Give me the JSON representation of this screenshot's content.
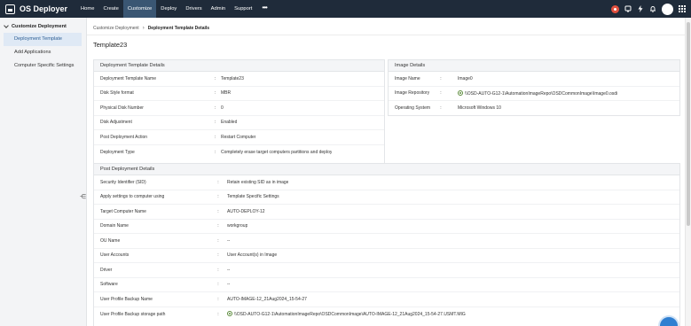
{
  "app": {
    "title": "OS Deployer"
  },
  "nav": {
    "items": [
      {
        "label": "Home",
        "active": false
      },
      {
        "label": "Create",
        "active": false
      },
      {
        "label": "Customize",
        "active": true
      },
      {
        "label": "Deploy",
        "active": false
      },
      {
        "label": "Drivers",
        "active": false
      },
      {
        "label": "Admin",
        "active": false
      },
      {
        "label": "Support",
        "active": false
      }
    ],
    "more": "•••"
  },
  "top_right_icons": [
    "alert-icon",
    "notifications-icon",
    "bolt-icon",
    "bell-icon",
    "user-avatar",
    "app-launcher-icon"
  ],
  "colors": {
    "topbar": "#1f2b3a",
    "active_nav": "#3a5673",
    "sidebar_active_bg": "#dfe9f5",
    "sidebar_active_text": "#2b5d94",
    "alert": "#e2503e"
  },
  "sidebar": {
    "section": "Customize Deployment",
    "items": [
      {
        "label": "Deployment Template",
        "active": true
      },
      {
        "label": "Add Applications",
        "active": false
      },
      {
        "label": "Computer Specific Settings",
        "active": false
      }
    ],
    "collapse_glyph": "⋲"
  },
  "breadcrumb": {
    "parent": "Customize Deployment",
    "separator": "›",
    "current": "Deployment Template Details"
  },
  "page_title": "Template23",
  "deployment_panel": {
    "title": "Deployment Template Details",
    "rows": [
      {
        "label": "Deployment Template Name",
        "sep": ":",
        "value": "Template23"
      },
      {
        "label": "Disk Style format",
        "sep": ":",
        "value": "MBR"
      },
      {
        "label": "Physical Disk Number",
        "sep": ":",
        "value": "0"
      },
      {
        "label": "Disk Adjustment",
        "sep": ":",
        "value": "Enabled"
      },
      {
        "label": "Post Deployment Action",
        "sep": ":",
        "value": "Restart Computer"
      },
      {
        "label": "Deployment Type",
        "sep": ":",
        "value": "Completely erase target computers partitions and deploy"
      }
    ]
  },
  "image_panel": {
    "title": "Image Details",
    "rows": [
      {
        "label": "Image Name",
        "sep": ":",
        "value": "Image0"
      },
      {
        "label": "Image Repository",
        "sep": ":",
        "value": "\\\\OSD-AUTO-G12-1\\AutomationImageRepo\\OSDCommonImage\\Image0.osdi",
        "icon": "network-share-icon"
      },
      {
        "label": "Operating System",
        "sep": ":",
        "value": "Microsoft Windows 10"
      }
    ]
  },
  "post_panel": {
    "title": "Post Deployment Details",
    "rows": [
      {
        "label": "Security Identifier (SID)",
        "sep": ":",
        "value": "Retain existing SID as in image"
      },
      {
        "label": "Apply settings to computer using",
        "sep": ":",
        "value": "Template Specific Settings"
      },
      {
        "label": "Target Computer Name",
        "sep": ":",
        "value": "AUTO-DEPLOY-12"
      },
      {
        "label": "Domain Name",
        "sep": ":",
        "value": "workgroup"
      },
      {
        "label": "OU Name",
        "sep": ":",
        "value": "--"
      },
      {
        "label": "User Accounts",
        "sep": ":",
        "value": "User Account(s) in Image"
      },
      {
        "label": "Driver",
        "sep": ":",
        "value": "--"
      },
      {
        "label": "Software",
        "sep": ":",
        "value": "--"
      },
      {
        "label": "User Profile Backup Name",
        "sep": ":",
        "value": "AUTO-IMAGE-12_21Aug2024_15-54-27"
      },
      {
        "label": "User Profile Backup storage path",
        "sep": ":",
        "value": "\\\\OSD-AUTO-G12-1\\AutomationImageRepo\\OSDCommonImage\\AUTO-IMAGE-12_21Aug2024_15-54-27.USMT.MIG",
        "icon": "network-share-icon"
      }
    ]
  }
}
